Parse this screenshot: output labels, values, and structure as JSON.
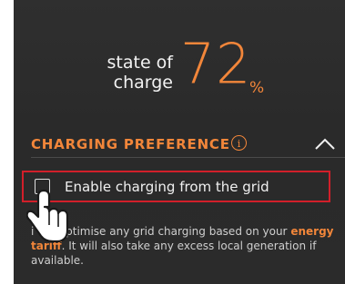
{
  "state_of_charge": {
    "label_line1": "state of",
    "label_line2": "charge",
    "value": "72",
    "unit": "%",
    "level_percent": 72
  },
  "charging_preference": {
    "title": "CHARGING PREFERENCE",
    "info_icon": "info-icon",
    "collapse_icon": "chevron-up-icon",
    "option": {
      "label": "Enable charging from the grid",
      "checked": false
    },
    "description_start": "i will optimise any grid charging based on your",
    "tariff_link": "energy tariff",
    "description_end": ". It will also take any excess local generation if available."
  },
  "colors": {
    "accent": "#f2863a",
    "highlight": "#d21f2a",
    "background": "#2d2d2d"
  }
}
